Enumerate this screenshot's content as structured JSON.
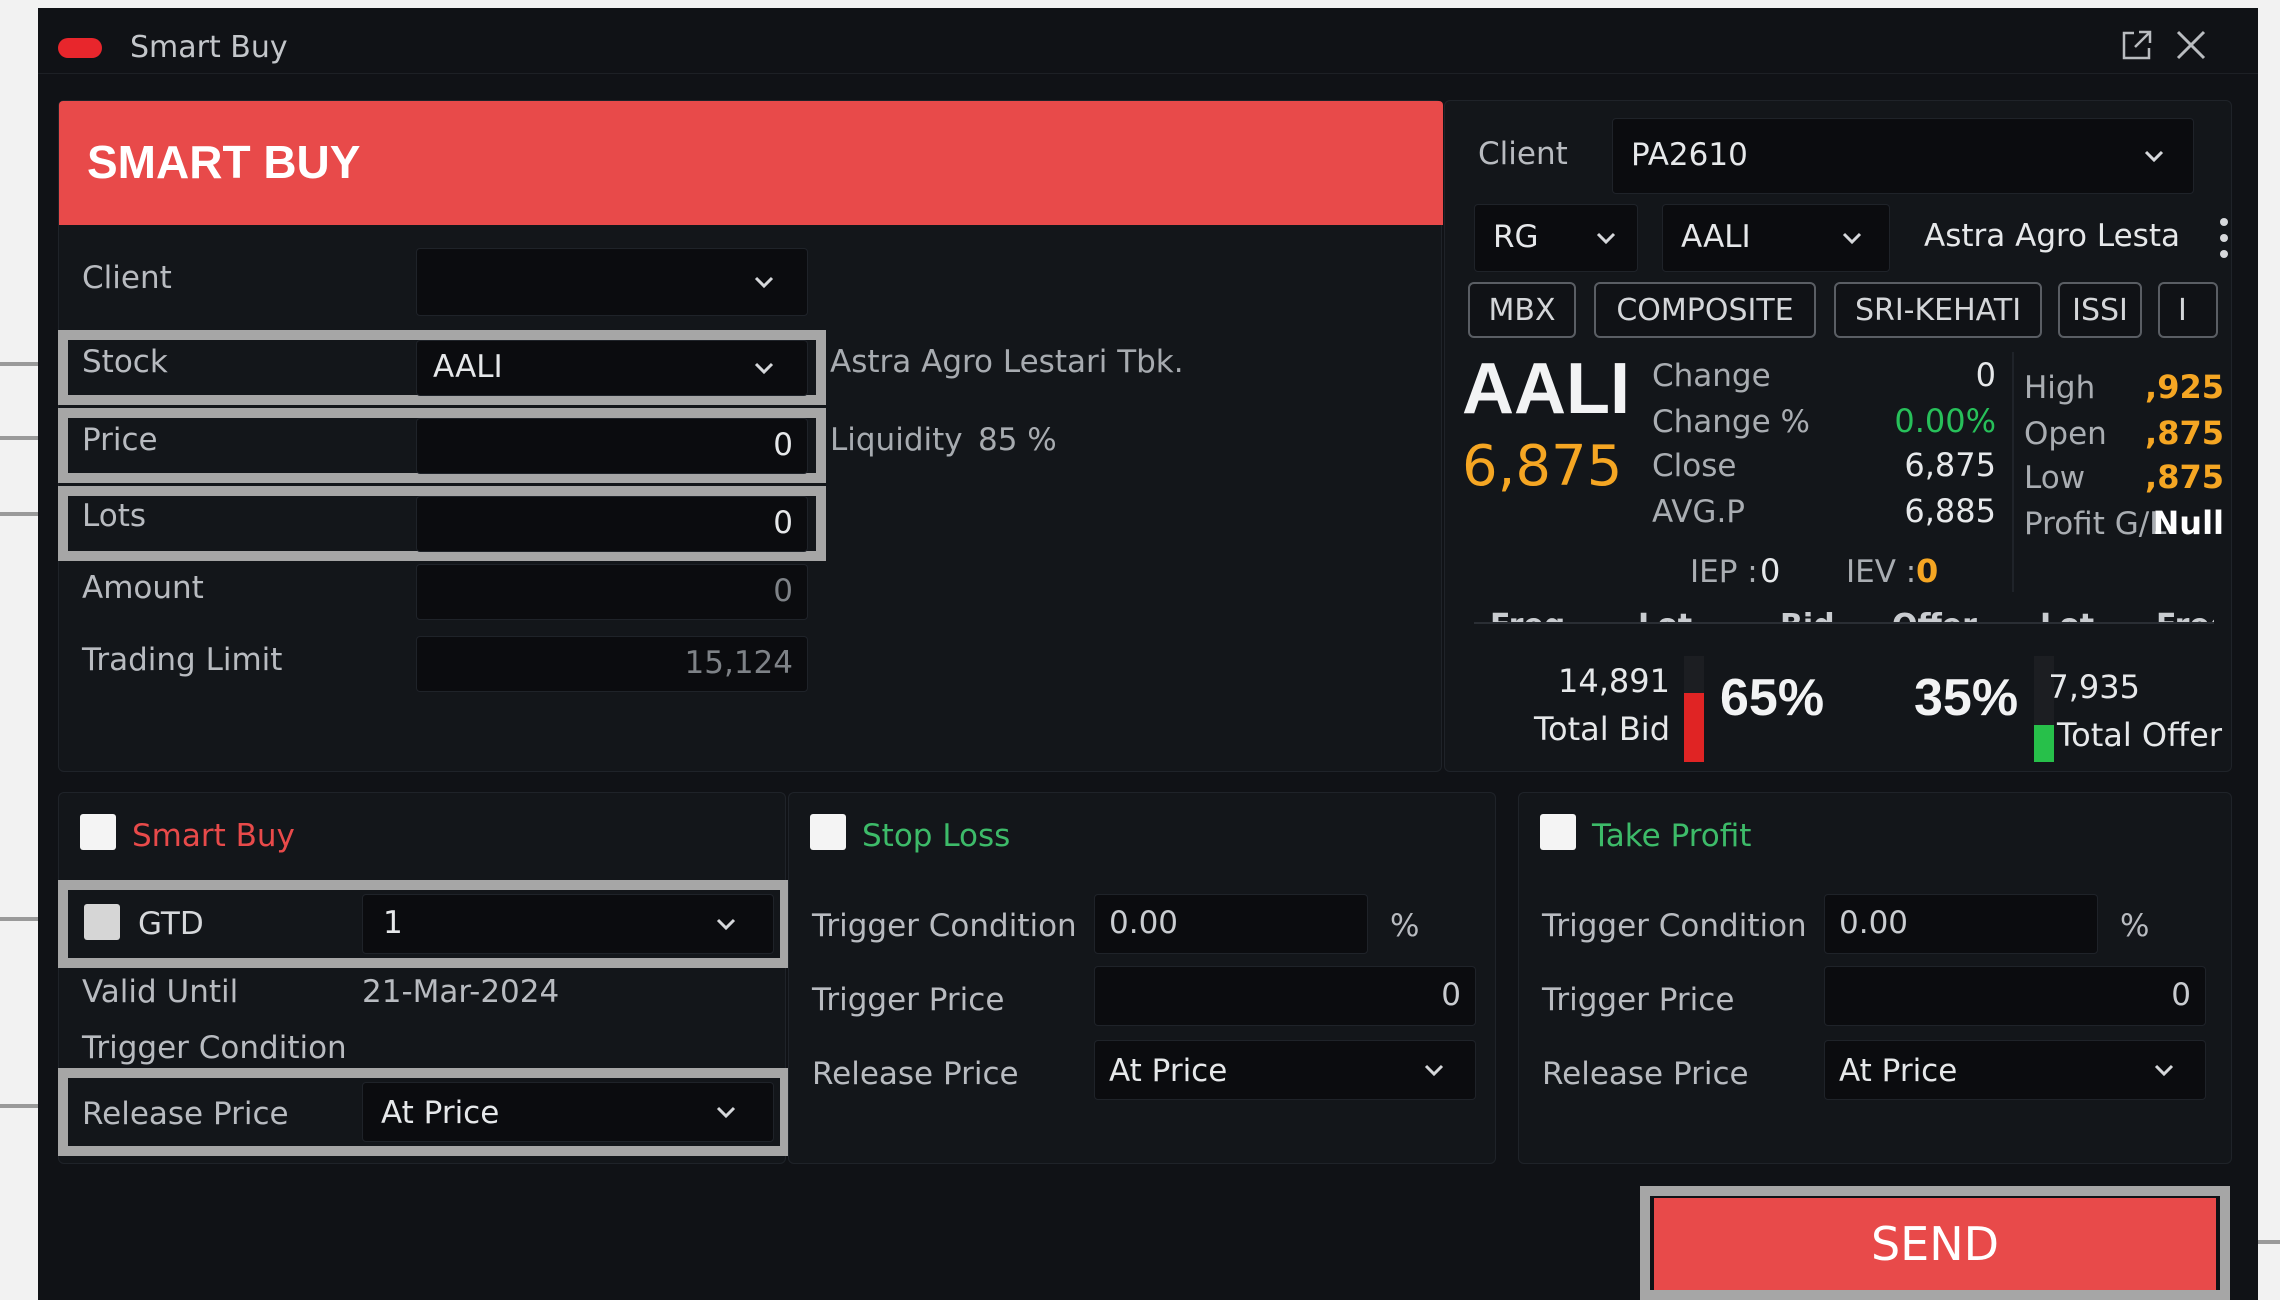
{
  "window": {
    "title": "Smart Buy"
  },
  "order": {
    "header": "SMART BUY",
    "client_label": "Client",
    "client_value": "",
    "stock_label": "Stock",
    "stock_value": "AALI",
    "stock_name": "Astra Agro Lestari Tbk.",
    "price_label": "Price",
    "price_value": "0",
    "liquidity_label": "Liquidity",
    "liquidity_value": "85 %",
    "lots_label": "Lots",
    "lots_value": "0",
    "amount_label": "Amount",
    "amount_value": "0",
    "trading_limit_label": "Trading Limit",
    "trading_limit_value": "15,124"
  },
  "quote": {
    "client_label": "Client",
    "client_value": "PA2610",
    "board_value": "RG",
    "stock_value": "AALI",
    "stock_name": "Astra Agro Lesta",
    "indices": [
      "MBX",
      "COMPOSITE",
      "SRI-KEHATI",
      "ISSI",
      "I"
    ],
    "symbol": "AALI",
    "last_price": "6,875",
    "change_label": "Change",
    "change_value": "0",
    "change_pct_label": "Change %",
    "change_pct_value": "0.00%",
    "close_label": "Close",
    "close_value": "6,875",
    "avgp_label": "AVG.P",
    "avgp_value": "6,885",
    "high_label": "High",
    "high_value": ",925",
    "open_label": "Open",
    "open_value": ",875",
    "low_label": "Low",
    "low_value": ",875",
    "pgl_label": "Profit G/L",
    "pgl_value": "Null",
    "iep_label": "IEP :",
    "iep_value": "0",
    "iev_label": "IEV :",
    "iev_value": "0",
    "columns": [
      "Freq",
      "Lot",
      "Bid",
      "Offer",
      "Lot",
      "Freq"
    ],
    "total_bid_value": "14,891",
    "total_bid_label": "Total Bid",
    "bid_pct": "65%",
    "bid_fraction": 0.65,
    "offer_pct": "35%",
    "offer_fraction": 0.35,
    "total_offer_value": "7,935",
    "total_offer_label": "Total Offer"
  },
  "smart_buy": {
    "title": "Smart Buy",
    "gtd_label": "GTD",
    "gtd_value": "1",
    "valid_until_label": "Valid Until",
    "valid_until_value": "21-Mar-2024",
    "trigger_condition_label": "Trigger Condition",
    "release_price_label": "Release Price",
    "release_price_value": "At Price"
  },
  "stop_loss": {
    "title": "Stop Loss",
    "trigger_condition_label": "Trigger Condition",
    "trigger_condition_value": "0.00",
    "pct_sign": "%",
    "trigger_price_label": "Trigger Price",
    "trigger_price_value": "0",
    "release_price_label": "Release Price",
    "release_price_value": "At Price"
  },
  "take_profit": {
    "title": "Take Profit",
    "trigger_condition_label": "Trigger Condition",
    "trigger_condition_value": "0.00",
    "pct_sign": "%",
    "trigger_price_label": "Trigger Price",
    "trigger_price_value": "0",
    "release_price_label": "Release Price",
    "release_price_value": "At Price"
  },
  "actions": {
    "send_label": "SEND"
  },
  "colors": {
    "accent_red": "#e84a4a",
    "title_green": "#3dbb69",
    "price_orange": "#f5a623",
    "percent_green": "#27c05a",
    "bid_bar": "#e02424",
    "offer_bar": "#27c04a"
  },
  "icons": {
    "popout": "popout-icon",
    "close": "close-icon",
    "dropdown": "chevron-down-icon",
    "menu": "more-vertical-icon"
  }
}
